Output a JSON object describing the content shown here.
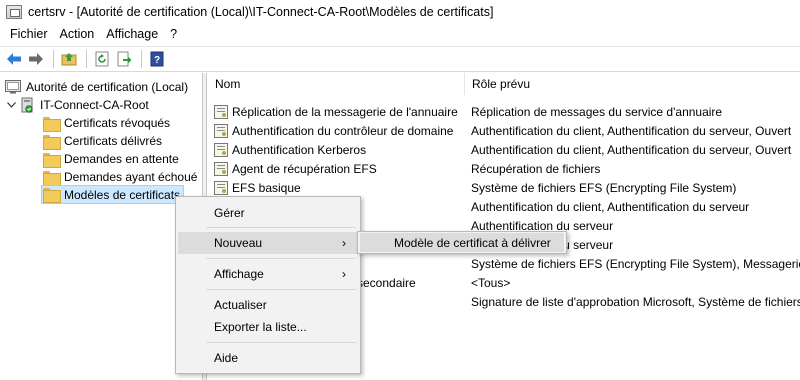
{
  "window": {
    "title": "certsrv - [Autorité de certification (Local)\\IT-Connect-CA-Root\\Modèles de certificats]"
  },
  "menubar": {
    "items": [
      "Fichier",
      "Action",
      "Affichage",
      "?"
    ]
  },
  "toolbar": {
    "icons": [
      "back-arrow-icon",
      "forward-arrow-icon",
      "up-folder-icon",
      "refresh-icon",
      "export-list-icon",
      "help-book-icon"
    ]
  },
  "tree": {
    "root": "Autorité de certification (Local)",
    "ca": "IT-Connect-CA-Root",
    "children": [
      "Certificats révoqués",
      "Certificats délivrés",
      "Demandes en attente",
      "Demandes ayant échoué",
      "Modèles de certificats"
    ]
  },
  "list": {
    "columns": {
      "name": "Nom",
      "purpose": "Rôle prévu"
    },
    "rows": [
      {
        "name": "Réplication de la messagerie de l'annuaire",
        "purpose": "Réplication de messages du service d'annuaire"
      },
      {
        "name": "Authentification du contrôleur de domaine",
        "purpose": "Authentification du client, Authentification du serveur, Ouvert"
      },
      {
        "name": "Authentification Kerberos",
        "purpose": "Authentification du client, Authentification du serveur, Ouvert"
      },
      {
        "name": "Agent de récupération EFS",
        "purpose": "Récupération de fichiers"
      },
      {
        "name": "EFS basique",
        "purpose": "Système de fichiers EFS (Encrypting File System)"
      },
      {
        "name": "",
        "purpose": "Authentification du client, Authentification du serveur"
      },
      {
        "name": "",
        "purpose": "Authentification du serveur"
      },
      {
        "name": "",
        "purpose": "Authentification du serveur"
      },
      {
        "name": "",
        "purpose": "Système de fichiers EFS (Encrypting File System), Messagerie él"
      },
      {
        "name": "secondaire",
        "purpose": "<Tous>"
      },
      {
        "name": "",
        "purpose": "Signature de liste d'approbation Microsoft, Système de fichiers"
      }
    ]
  },
  "context_menu": {
    "items": {
      "manage": "Gérer",
      "new": "Nouveau",
      "view": "Affichage",
      "refresh": "Actualiser",
      "export": "Exporter la liste...",
      "help": "Aide"
    },
    "arrow": "›"
  },
  "submenu": {
    "item": "Modèle de certificat à délivrer"
  }
}
